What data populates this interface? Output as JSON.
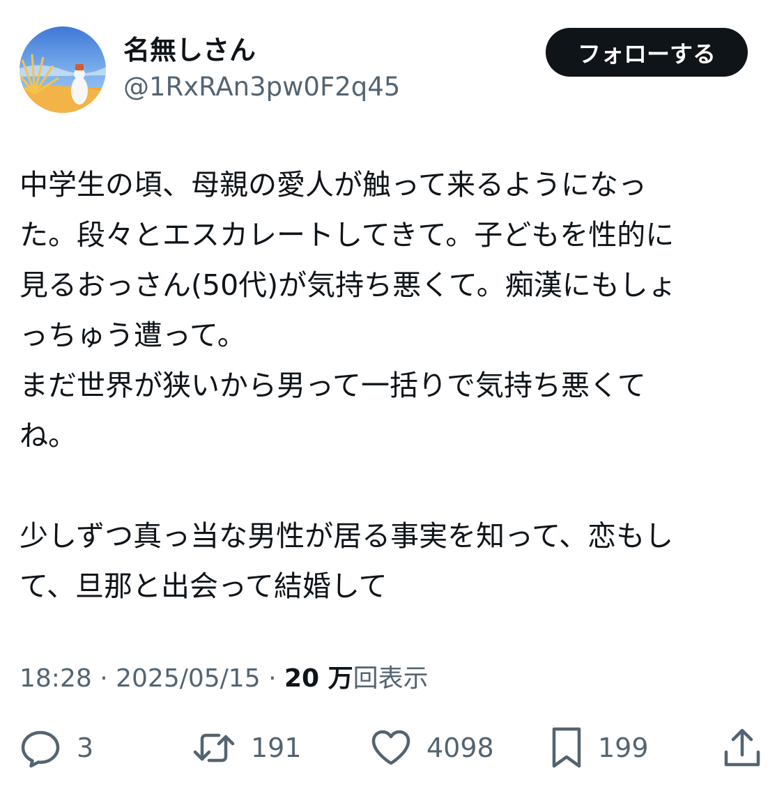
{
  "author": {
    "display_name": "名無しさん",
    "handle": "@1RxRAn3pw0F2q45",
    "follow_label": "フォローする",
    "avatar_icon": "avatar-image-icon"
  },
  "tweet": {
    "lines": [
      "中学生の頃、母親の愛人が触って来るようになっ",
      "た。段々とエスカレートしてきて。子どもを性的に",
      "見るおっさん(50代)が気持ち悪くて。痴漢にもしょ",
      "っちゅう遭って。",
      "まだ世界が狭いから男って一括りで気持ち悪くて",
      "ね。",
      "",
      "少しずつ真っ当な男性が居る事実を知って、恋もし",
      "て、旦那と出会って結婚して"
    ]
  },
  "meta": {
    "time": "18:28",
    "separator": "·",
    "date": "2025/05/15",
    "views_count": "20 万",
    "views_label": "回表示"
  },
  "actions": {
    "reply": {
      "icon": "reply-icon",
      "count": "3"
    },
    "retweet": {
      "icon": "retweet-icon",
      "count": "191"
    },
    "like": {
      "icon": "heart-icon",
      "count": "4098"
    },
    "bookmark": {
      "icon": "bookmark-icon",
      "count": "199"
    },
    "share": {
      "icon": "share-icon"
    }
  },
  "colors": {
    "text_primary": "#0f1419",
    "text_secondary": "#536471",
    "button_bg": "#0f1419",
    "button_text": "#ffffff"
  }
}
